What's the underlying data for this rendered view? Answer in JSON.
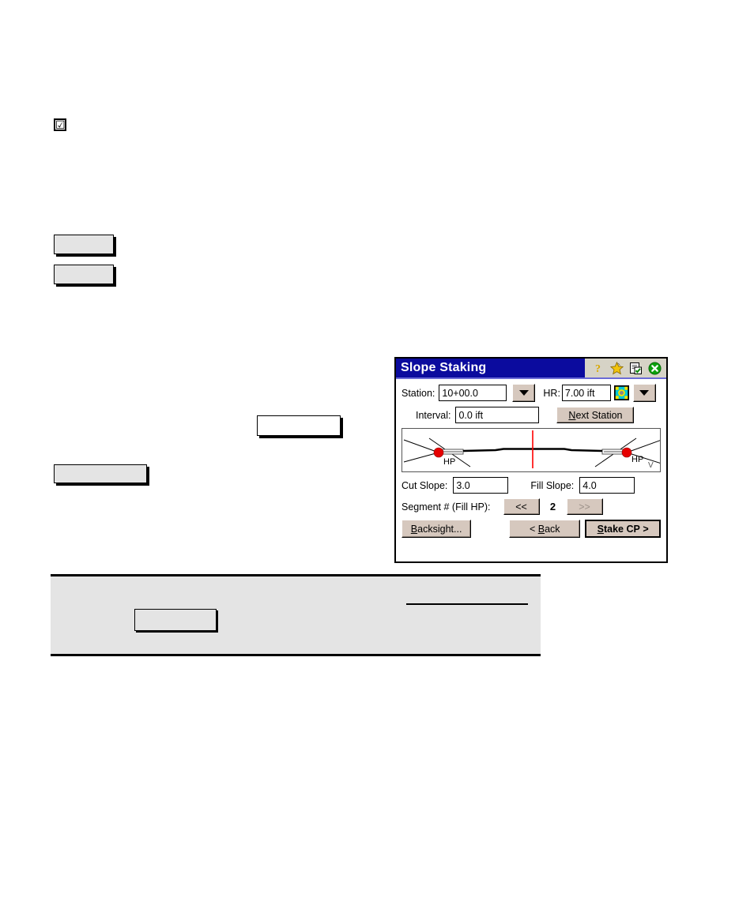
{
  "document": {
    "checkbox": {
      "checked": true,
      "glyph": "☑"
    }
  },
  "dialog": {
    "title": "Slope Staking",
    "titlebar_icons": [
      {
        "name": "help-icon",
        "label": "?"
      },
      {
        "name": "favorites-star-icon",
        "label": "star"
      },
      {
        "name": "notes-checklist-icon",
        "label": "notes"
      },
      {
        "name": "close-icon",
        "label": "close"
      }
    ],
    "colors": {
      "titlebar": "#0b0b9e",
      "titlebar_text": "#ffffff",
      "button_face": "#d6c8be",
      "icon_tray": "#d6d3c6",
      "close_green": "#0ca00c",
      "star_yellow": "#f2c40c",
      "centerline_red": "#ff0000",
      "catch_point_red": "#e60000"
    },
    "fields": {
      "station_label": "Station:",
      "station_value": "10+00.0",
      "hr_label": "HR:",
      "hr_value": "7.00 ift",
      "interval_label": "Interval:",
      "interval_value": "0.0 ift",
      "next_station_button": "Next Station",
      "next_station_accel": "N",
      "cut_slope_label": "Cut Slope:",
      "cut_slope_value": "3.0",
      "fill_slope_label": "Fill Slope:",
      "fill_slope_value": "4.0",
      "segment_label": "Segment # (Fill HP):",
      "segment_prev": "<<",
      "segment_value": "2",
      "segment_next": ">>",
      "segment_next_disabled": true
    },
    "buttons": {
      "backsight": "Backsight...",
      "backsight_accel": "B",
      "back": "< Back",
      "back_accel": "B",
      "stake_cp": "Stake CP >",
      "stake_cp_accel": "S"
    },
    "diagram": {
      "left_label": "HP",
      "right_label": "HP",
      "right_sub_label": "V",
      "centerline": true
    }
  }
}
